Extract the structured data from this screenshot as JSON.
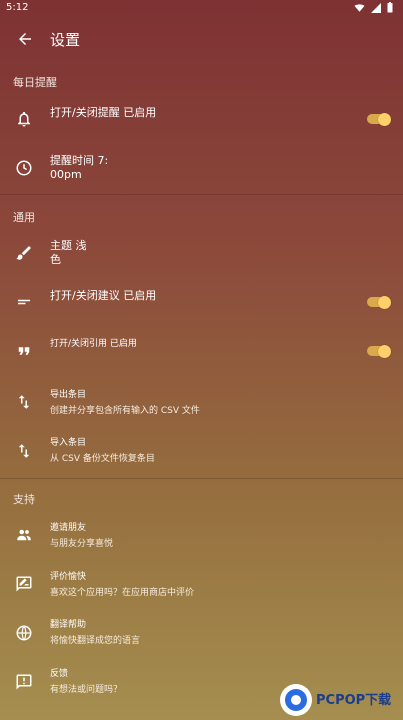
{
  "status": {
    "time": "5:12"
  },
  "header": {
    "title": "设置"
  },
  "sections": {
    "daily": "每日提醒",
    "general": "通用",
    "support": "支持"
  },
  "daily": {
    "toggle_reminder": "打开/关闭提醒 已启用",
    "reminder_time_line1": "提醒时间 7:",
    "reminder_time_line2": "00pm"
  },
  "general": {
    "theme_line1": "主题 浅",
    "theme_line2": "色",
    "toggle_suggestions": "打开/关闭建议 已启用",
    "toggle_quotes": "打开/关闭引用 已启用",
    "export_title": "导出条目",
    "export_sub": "创建并分享包含所有输入的 CSV 文件",
    "import_title": "导入条目",
    "import_sub": "从 CSV 备份文件恢复条目"
  },
  "support": {
    "invite_title": "邀请朋友",
    "invite_sub": "与朋友分享喜悦",
    "rate_title": "评价愉快",
    "rate_sub": "喜欢这个应用吗？在应用商店中评价",
    "translate_title": "翻译帮助",
    "translate_sub": "将愉快翻译成您的语言",
    "feedback_title": "反馈",
    "feedback_sub": "有想法或问题吗？"
  },
  "watermark": {
    "text": "PCPOP下载"
  },
  "toggles": {
    "reminder": true,
    "suggestions": true,
    "quotes": true
  },
  "colors": {
    "accent": "#ffd06a",
    "track": "#d9a94a"
  }
}
